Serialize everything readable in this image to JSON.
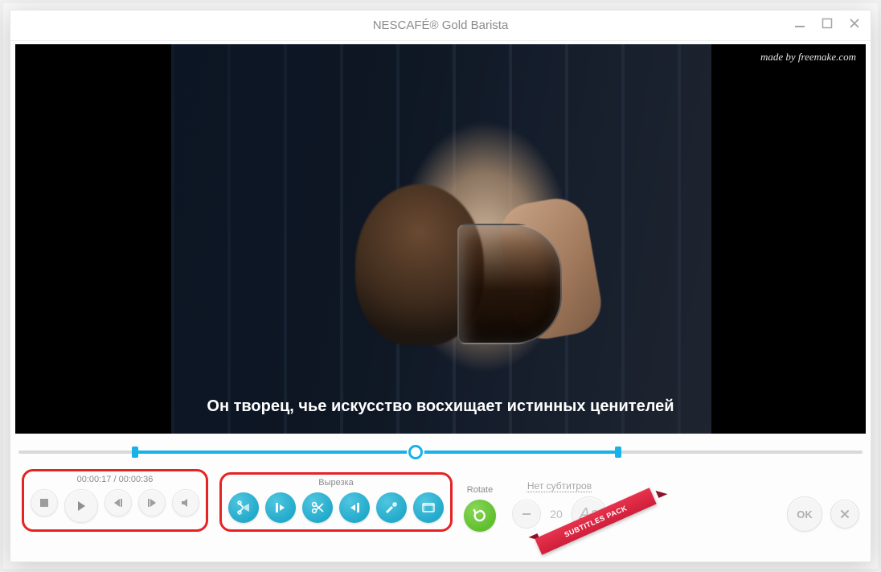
{
  "window": {
    "title": "NESCAFÉ® Gold Barista"
  },
  "video": {
    "watermark": "made by freemake.com",
    "subtitle": "Он творец, чье искусство восхищает истинных ценителей"
  },
  "timeline": {
    "selection_start_pct": 13.8,
    "selection_end_pct": 71.0,
    "playhead_pct": 47.0
  },
  "playback": {
    "time_label": "00:00:17 / 00:00:36",
    "icons": {
      "stop": "stop-icon",
      "play": "play-icon",
      "prev_frame": "prev-frame-icon",
      "next_frame": "next-frame-icon",
      "volume": "volume-icon"
    }
  },
  "cut": {
    "label": "Вырезка",
    "icons": {
      "cut_with_pointer": "cut-pointer-icon",
      "mark_in": "mark-in-icon",
      "scissors": "scissors-icon",
      "mark_out": "mark-out-icon",
      "cut_clip": "cut-clip-icon",
      "film": "film-icon"
    }
  },
  "rotate": {
    "label": "Rotate",
    "icon": "rotate-ccw-icon"
  },
  "subtitles": {
    "link_label": "Нет субтитров",
    "minus_icon": "minus-icon",
    "font_size_value": "20",
    "aa_label": "Aa",
    "ribbon_text": "SUBTITLES PACK"
  },
  "footer": {
    "ok_label": "OK",
    "close_icon": "close-icon"
  },
  "colors": {
    "accent_teal": "#23aacb",
    "accent_green": "#5fbf2e",
    "highlight_red": "#e62323",
    "ribbon_red": "#cf1f3b"
  }
}
